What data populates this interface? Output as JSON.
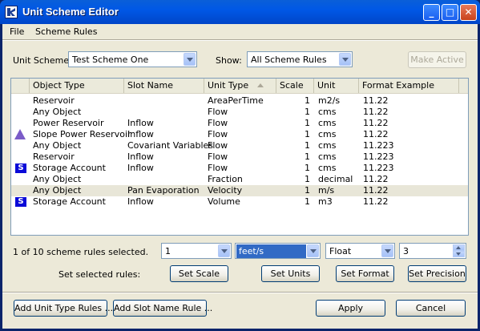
{
  "window": {
    "title": "Unit Scheme Editor"
  },
  "menubar": [
    "File",
    "Scheme Rules"
  ],
  "toolbar": {
    "unit_scheme_label": "Unit Scheme:",
    "unit_scheme_value": "Test Scheme One",
    "show_label": "Show:",
    "show_value": "All Scheme Rules",
    "make_active": "Make Active"
  },
  "table": {
    "columns": [
      "Object Type",
      "Slot Name",
      "Unit Type",
      "Scale",
      "Unit",
      "Format Example"
    ],
    "rows": [
      {
        "icon": "",
        "object_type": "Reservoir",
        "slot_name": "",
        "unit_type": "AreaPerTime",
        "scale": "1",
        "unit": "m2/s",
        "format": "11.22"
      },
      {
        "icon": "",
        "object_type": "Any Object",
        "slot_name": "",
        "unit_type": "Flow",
        "scale": "1",
        "unit": "cms",
        "format": "11.22"
      },
      {
        "icon": "",
        "object_type": "Power Reservoir",
        "slot_name": "Inflow",
        "unit_type": "Flow",
        "scale": "1",
        "unit": "cms",
        "format": "11.22"
      },
      {
        "icon": "slope-power-reservoir-icon",
        "object_type": "Slope Power Reservoir",
        "slot_name": "Inflow",
        "unit_type": "Flow",
        "scale": "1",
        "unit": "cms",
        "format": "11.22"
      },
      {
        "icon": "",
        "object_type": "Any Object",
        "slot_name": "Covariant Variables",
        "unit_type": "Flow",
        "scale": "1",
        "unit": "cms",
        "format": "11.223"
      },
      {
        "icon": "",
        "object_type": "Reservoir",
        "slot_name": "Inflow",
        "unit_type": "Flow",
        "scale": "1",
        "unit": "cms",
        "format": "11.223"
      },
      {
        "icon": "storage-account-icon",
        "object_type": "Storage Account",
        "slot_name": "Inflow",
        "unit_type": "Flow",
        "scale": "1",
        "unit": "cms",
        "format": "11.223"
      },
      {
        "icon": "",
        "object_type": "Any Object",
        "slot_name": "",
        "unit_type": "Fraction",
        "scale": "1",
        "unit": "decimal",
        "format": "11.22"
      },
      {
        "icon": "",
        "object_type": "Any Object",
        "slot_name": "Pan Evaporation",
        "unit_type": "Velocity",
        "scale": "1",
        "unit": "m/s",
        "format": "11.22"
      },
      {
        "icon": "storage-account-icon",
        "object_type": "Storage Account",
        "slot_name": "Inflow",
        "unit_type": "Volume",
        "scale": "1",
        "unit": "m3",
        "format": "11.22"
      }
    ],
    "storage_icon_letter": "S"
  },
  "selection": {
    "status": "1 of 10 scheme rules selected.",
    "scale_value": "1",
    "units_value": "feet/s",
    "format_value": "Float",
    "precision_value": "3",
    "set_label": "Set selected rules:",
    "set_scale": "Set Scale",
    "set_units": "Set Units",
    "set_format": "Set Format",
    "set_precision": "Set Precision"
  },
  "footer": {
    "add_unit_type": "Add Unit Type Rules ...",
    "add_slot_name": "Add Slot Name Rule ...",
    "apply": "Apply",
    "cancel": "Cancel"
  }
}
